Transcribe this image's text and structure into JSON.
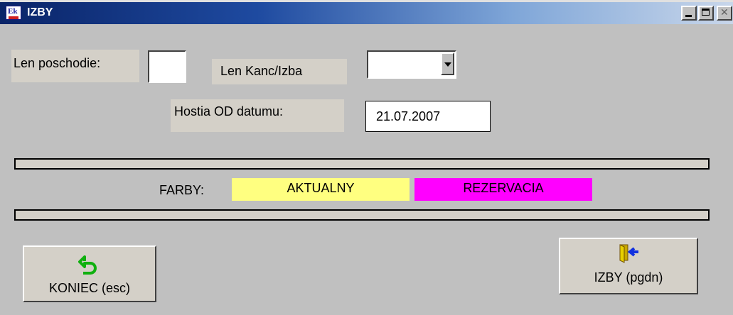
{
  "window": {
    "title": "IZBY"
  },
  "filters": {
    "floor_label": "Len poschodie:",
    "floor_value": "",
    "type_label": "Len Kanc/Izba",
    "type_value": "",
    "date_label": "Hostia OD datumu:",
    "date_value": "21.07.2007"
  },
  "legend": {
    "label": "FARBY:",
    "items": [
      {
        "label": "AKTUALNY",
        "color": "#ffff80"
      },
      {
        "label": "REZERVACIA",
        "color": "#ff00ff"
      }
    ]
  },
  "buttons": {
    "exit_label": "KONIEC (esc)",
    "exit_icon": "undo-arrow-icon",
    "rooms_label": "IZBY (pgdn)",
    "rooms_icon": "door-enter-icon"
  }
}
